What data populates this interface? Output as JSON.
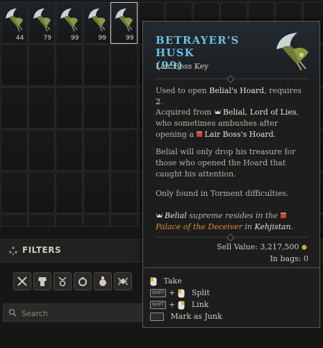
{
  "inventory": {
    "slots": [
      {
        "count": "44"
      },
      {
        "count": "79"
      },
      {
        "count": "99"
      },
      {
        "count": "99"
      },
      {
        "count": "99"
      }
    ]
  },
  "filters": {
    "title": "FILTERS",
    "buttons": [
      "weapon-filter",
      "armor-filter",
      "amulet-filter",
      "ring-filter",
      "potion-filter",
      "spider-filter"
    ],
    "search_placeholder": "Search"
  },
  "tooltip": {
    "name": "BETRAYER'S HUSK",
    "quantity": "(99)",
    "type": "Lair Boss Key",
    "usage_pre": "Used to open ",
    "usage_target": "Belial's Hoard",
    "usage_mid": ", requires ",
    "usage_count": "2",
    "usage_post": ".",
    "acquired_pre": "Acquired from ",
    "acquired_boss": "Belial, Lord of Lies",
    "acquired_mid": ", who sometimes ambushes after opening a ",
    "acquired_target": "Lair Boss's Hoard",
    "acquired_post": ".",
    "lore": "Belial will only drop his treasure for those who opened the Hoard that caught his attention.",
    "difficulty": "Only found in Torment difficulties.",
    "location_boss": "Belial",
    "location_mid": " supreme resides in the ",
    "location_place": "Palace of the Deceiver",
    "location_in": " in ",
    "location_region": "Kehjistan",
    "location_end": ".",
    "sell_value": "Sell Value: 3,217,500",
    "in_bags": "In bags: 0",
    "colors": {
      "name": "#6fbfe3",
      "boss": "#e07a5a",
      "place": "#d8912f"
    }
  },
  "actions": {
    "take": "Take",
    "split": "Split",
    "link": "Link",
    "junk": "Mark as Junk",
    "shift_key": "SHIFT"
  }
}
